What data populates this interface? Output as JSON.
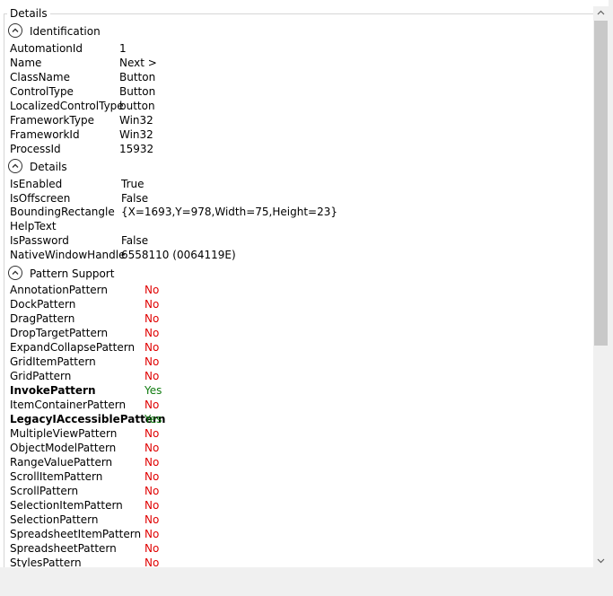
{
  "details_group": {
    "title": "Details"
  },
  "identification": {
    "header": "Identification",
    "rows": [
      {
        "key": "AutomationId",
        "value": "1"
      },
      {
        "key": "Name",
        "value": "Next >"
      },
      {
        "key": "ClassName",
        "value": "Button"
      },
      {
        "key": "ControlType",
        "value": "Button"
      },
      {
        "key": "LocalizedControlType",
        "value": "button"
      },
      {
        "key": "FrameworkType",
        "value": "Win32"
      },
      {
        "key": "FrameworkId",
        "value": "Win32"
      },
      {
        "key": "ProcessId",
        "value": "15932"
      }
    ]
  },
  "details": {
    "header": "Details",
    "rows": [
      {
        "key": "IsEnabled",
        "value": "True"
      },
      {
        "key": "IsOffscreen",
        "value": "False"
      },
      {
        "key": "BoundingRectangle",
        "value": "{X=1693,Y=978,Width=75,Height=23}"
      },
      {
        "key": "HelpText",
        "value": ""
      },
      {
        "key": "IsPassword",
        "value": "False"
      },
      {
        "key": "NativeWindowHandle",
        "value": "6558110 (0064119E)"
      }
    ]
  },
  "pattern_support": {
    "header": "Pattern Support",
    "rows": [
      {
        "key": "AnnotationPattern",
        "value": "No"
      },
      {
        "key": "DockPattern",
        "value": "No"
      },
      {
        "key": "DragPattern",
        "value": "No"
      },
      {
        "key": "DropTargetPattern",
        "value": "No"
      },
      {
        "key": "ExpandCollapsePattern",
        "value": "No"
      },
      {
        "key": "GridItemPattern",
        "value": "No"
      },
      {
        "key": "GridPattern",
        "value": "No"
      },
      {
        "key": "InvokePattern",
        "value": "Yes"
      },
      {
        "key": "ItemContainerPattern",
        "value": "No"
      },
      {
        "key": "LegacyIAccessiblePattern",
        "value": "Yes"
      },
      {
        "key": "MultipleViewPattern",
        "value": "No"
      },
      {
        "key": "ObjectModelPattern",
        "value": "No"
      },
      {
        "key": "RangeValuePattern",
        "value": "No"
      },
      {
        "key": "ScrollItemPattern",
        "value": "No"
      },
      {
        "key": "ScrollPattern",
        "value": "No"
      },
      {
        "key": "SelectionItemPattern",
        "value": "No"
      },
      {
        "key": "SelectionPattern",
        "value": "No"
      },
      {
        "key": "SpreadsheetItemPattern",
        "value": "No"
      },
      {
        "key": "SpreadsheetPattern",
        "value": "No"
      },
      {
        "key": "StylesPattern",
        "value": "No"
      }
    ]
  },
  "colors": {
    "yes": "#107c10",
    "no": "#e00000"
  }
}
